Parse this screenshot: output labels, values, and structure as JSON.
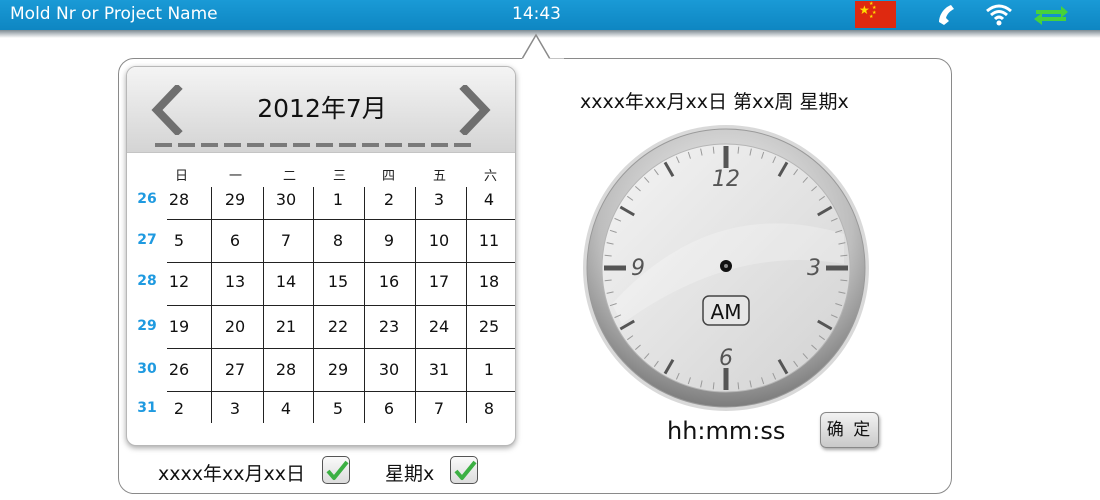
{
  "topbar": {
    "title": "Mold Nr or Project Name",
    "time": "14:43",
    "icons": [
      "china-flag-icon",
      "phone-icon",
      "wifi-icon",
      "transfer-arrows-icon"
    ],
    "accent": "#0e86c2"
  },
  "calendar": {
    "month_label": "2012年7月",
    "weekdays": [
      "日",
      "一",
      "二",
      "三",
      "四",
      "五",
      "六"
    ],
    "weeks": [
      {
        "num": "26",
        "days": [
          "28",
          "29",
          "30",
          "1",
          "2",
          "3",
          "4"
        ]
      },
      {
        "num": "27",
        "days": [
          "5",
          "6",
          "7",
          "8",
          "9",
          "10",
          "11"
        ]
      },
      {
        "num": "28",
        "days": [
          "12",
          "13",
          "14",
          "15",
          "16",
          "17",
          "18"
        ]
      },
      {
        "num": "29",
        "days": [
          "19",
          "20",
          "21",
          "22",
          "23",
          "24",
          "25"
        ]
      },
      {
        "num": "30",
        "days": [
          "26",
          "27",
          "28",
          "29",
          "30",
          "31",
          "1"
        ]
      },
      {
        "num": "31",
        "days": [
          "2",
          "3",
          "4",
          "5",
          "6",
          "7",
          "8"
        ]
      }
    ],
    "week_num_color": "#1f9ae0",
    "prev_icon": "chevron-left-icon",
    "next_icon": "chevron-right-icon"
  },
  "clock": {
    "date_line": "xxxx年xx月xx日 第xx周 星期x",
    "numerals": [
      "12",
      "3",
      "6",
      "9"
    ],
    "ampm": "AM",
    "time_format": "hh:mm:ss",
    "confirm_label": "确 定"
  },
  "options": {
    "date_label": "xxxx年xx月xx日",
    "weekday_label": "星期x",
    "date_checked": true,
    "weekday_checked": true,
    "check_color": "#3cb043"
  }
}
